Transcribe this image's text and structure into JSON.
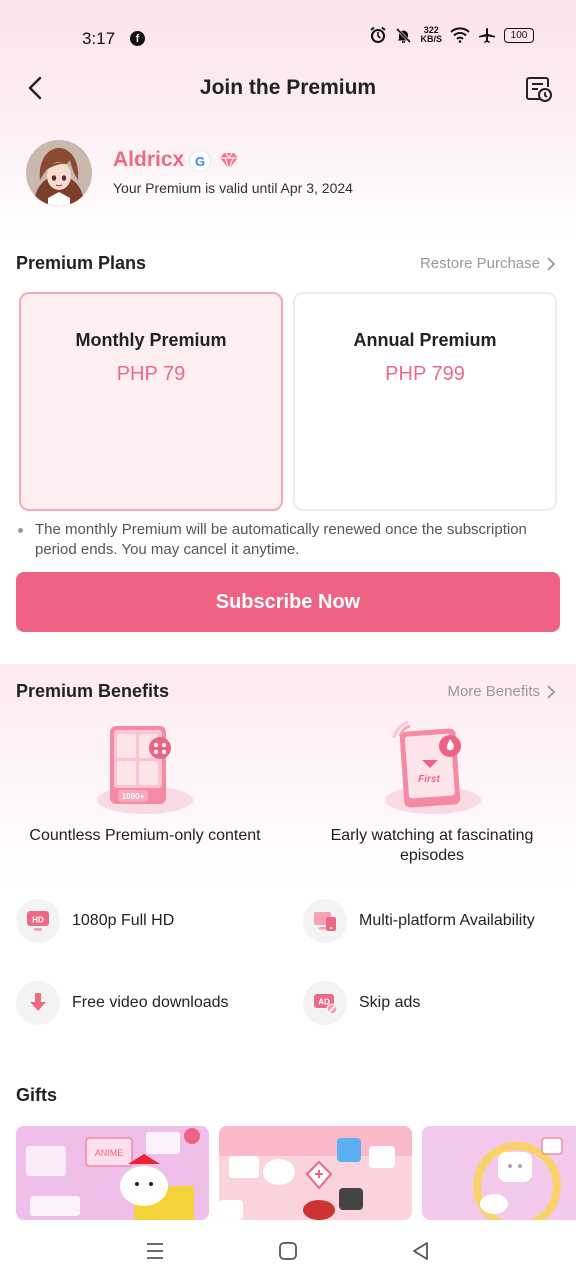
{
  "status_bar": {
    "time": "3:17",
    "net_speed_top": "322",
    "net_speed_bottom": "KB/S",
    "battery": "100"
  },
  "header": {
    "title": "Join the Premium",
    "back_icon": "chevron-left-icon",
    "history_icon": "purchase-history-icon"
  },
  "profile": {
    "name": "Aldricx",
    "google_badge": "G",
    "valid_text": "Your Premium is valid until Apr 3, 2024"
  },
  "plans": {
    "title": "Premium Plans",
    "restore_label": "Restore Purchase",
    "items": [
      {
        "name": "Monthly Premium",
        "price": "PHP 79",
        "selected": true
      },
      {
        "name": "Annual Premium",
        "price": "PHP 799",
        "selected": false
      }
    ],
    "note": "The monthly Premium will be automatically renewed once the subscription period ends. You may cancel it anytime.",
    "subscribe_label": "Subscribe Now"
  },
  "benefits": {
    "title": "Premium Benefits",
    "more_label": "More Benefits",
    "highlights": [
      {
        "caption": "Countless Premium-only content",
        "badge": "1000+"
      },
      {
        "caption": "Early watching at fascinating episodes",
        "badge": "First"
      }
    ],
    "features": [
      {
        "label": "1080p Full HD",
        "icon": "hd-icon",
        "icon_text": "HD"
      },
      {
        "label": "Multi-platform Availability",
        "icon": "multi-device-icon"
      },
      {
        "label": "Free video downloads",
        "icon": "download-icon"
      },
      {
        "label": "Skip ads",
        "icon": "skip-ads-icon",
        "icon_text": "AD"
      }
    ]
  },
  "gifts": {
    "title": "Gifts",
    "items": [
      {
        "name": "gift-card-1"
      },
      {
        "name": "gift-card-2"
      },
      {
        "name": "gift-card-3"
      }
    ]
  },
  "colors": {
    "accent": "#f06283",
    "accent_text": "#ec6a86",
    "selected_bg": "#fdeef1",
    "selected_border": "#f2a9b8"
  }
}
